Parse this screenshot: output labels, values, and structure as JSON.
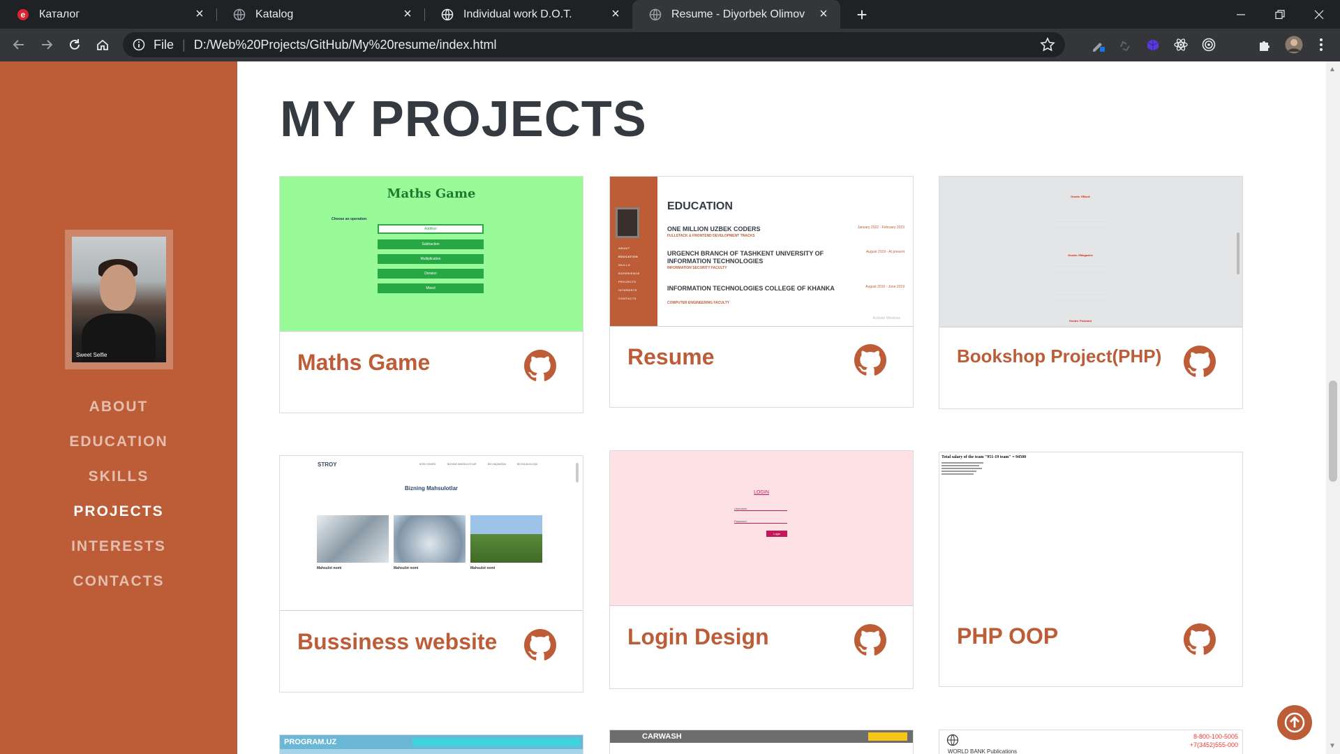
{
  "browser": {
    "tabs": [
      {
        "title": "Каталог",
        "active": false
      },
      {
        "title": "Katalog",
        "active": false
      },
      {
        "title": "Individual work D.O.T.",
        "active": false
      },
      {
        "title": "Resume - Diyorbek Olimov",
        "active": true
      }
    ],
    "address": {
      "scheme": "File",
      "url": "D:/Web%20Projects/GitHub/My%20resume/index.html"
    }
  },
  "sidebar": {
    "photo_brand": "Sweet Selfie",
    "nav": [
      {
        "label": "ABOUT",
        "active": false
      },
      {
        "label": "EDUCATION",
        "active": false
      },
      {
        "label": "SKILLS",
        "active": false
      },
      {
        "label": "PROJECTS",
        "active": true
      },
      {
        "label": "INTERESTS",
        "active": false
      },
      {
        "label": "CONTACTS",
        "active": false
      }
    ]
  },
  "main": {
    "heading": "MY PROJECTS",
    "projects": [
      {
        "title": "Maths Game"
      },
      {
        "title": "Resume"
      },
      {
        "title": "Bookshop Project(PHP)"
      },
      {
        "title": "Bussiness website"
      },
      {
        "title": "Login Design"
      },
      {
        "title": "PHP OOP"
      }
    ],
    "thumbs": {
      "maths": {
        "title": "Maths Game",
        "label": "Choose an operation:",
        "buttons": [
          "Addition",
          "Subtraction",
          "Multiplication",
          "Division",
          "Mixed"
        ]
      },
      "resume": {
        "heading": "EDUCATION",
        "nav": [
          "ABOUT",
          "EDUCATION",
          "SKILLS",
          "EXPERIENCE",
          "PROJECTS",
          "INTERESTS",
          "CONTACTS"
        ],
        "entries": [
          {
            "name": "ONE MILLION UZBEK CODERS",
            "sub": "FULLSTACK & FRONTEND DEVELOPMENT TRACKS",
            "date": "January 2022 - February 2023"
          },
          {
            "name": "URGENCH BRANCH OF TASHKENT UNIVERSITY OF INFORMATION TECHNOLOGIES",
            "sub": "INFORMATION SECURITY FACULTY",
            "date": "August 2019 - At present"
          },
          {
            "name": "INFORMATION TECHNOLOGIES COLLEGE OF KHANKA",
            "sub": "COMPUTER ENGINEERING FACULTY",
            "date": "August 2016 - June 2019"
          }
        ],
        "watermark": "Activate Windows"
      },
      "bookshop": {
        "section1": "Goods: EBook",
        "section2": "Goods: EMagazine",
        "section3": "Goods: Postcard"
      },
      "business": {
        "brand": "STROY",
        "menu": [
          "BOSH SAHIFA",
          "BIZNING MAHSULOTLAR",
          "BIZ HAQIMIZDA",
          "BIZ BILAN ALOQA"
        ],
        "heading": "Bizning Mahsulotlar",
        "item": "Mahsulot nomi"
      },
      "login": {
        "title": "LOGIN",
        "user": "Username",
        "pass": "Password",
        "button": "Login"
      },
      "phpoop": {
        "text": "Total salary of the team \"951-19 team\" = 94500"
      },
      "row3": {
        "program": "PROGRAM.UZ",
        "carwash": "CARWASH",
        "phone1": "8-800-100-5005",
        "phone2": "+7(3452)555-000",
        "world": "WORLD BANK Publications"
      }
    }
  },
  "colors": {
    "primary": "#bd5d38",
    "heading": "#343a40"
  }
}
